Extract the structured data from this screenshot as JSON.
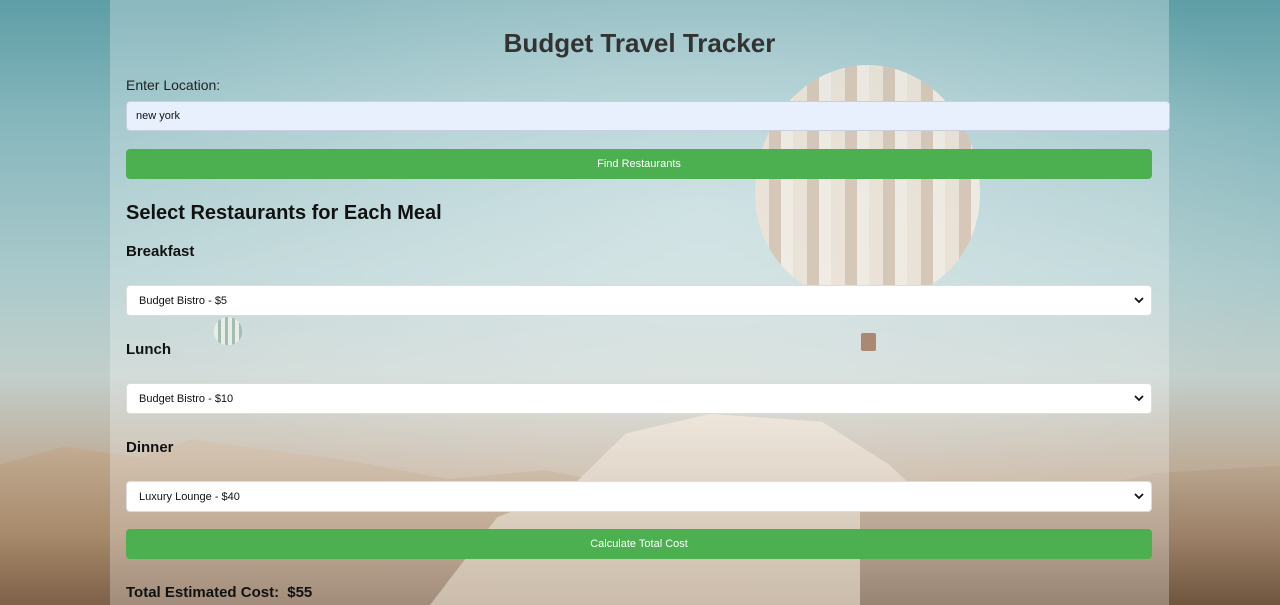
{
  "app": {
    "title": "Budget Travel Tracker"
  },
  "location": {
    "label": "Enter Location:",
    "value": "new york",
    "find_button_label": "Find Restaurants"
  },
  "meals": {
    "section_title": "Select Restaurants for Each Meal",
    "breakfast": {
      "label": "Breakfast",
      "selected": "Budget Bistro - $5"
    },
    "lunch": {
      "label": "Lunch",
      "selected": "Budget Bistro - $10"
    },
    "dinner": {
      "label": "Dinner",
      "selected": "Luxury Lounge - $40"
    }
  },
  "calculate_button_label": "Calculate Total Cost",
  "total": {
    "label": "Total Estimated Cost:",
    "value": "$55"
  },
  "colors": {
    "button": "#4caf50",
    "input_background": "#e8f0fe",
    "title_text": "#333333"
  },
  "icons": {
    "select_chevron": "chevron-down-icon"
  }
}
